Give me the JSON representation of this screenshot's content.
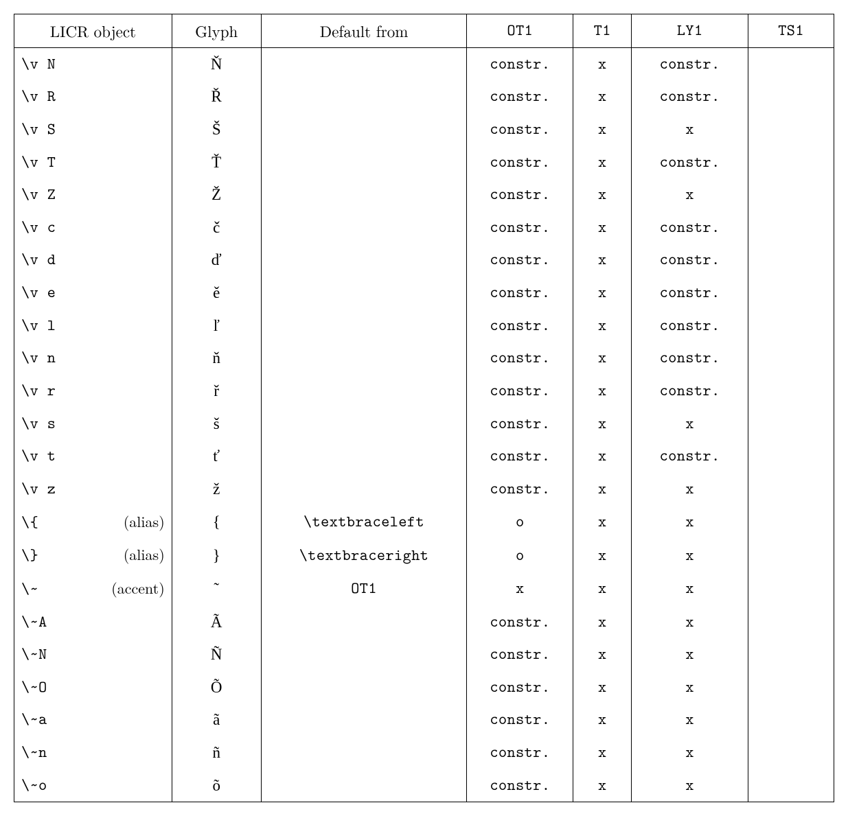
{
  "headers": {
    "licr": "LICR object",
    "glyph": "Glyph",
    "default_from": "Default from",
    "ot1": "OT1",
    "t1": "T1",
    "ly1": "LY1",
    "ts1": "TS1"
  },
  "rows": [
    {
      "licr": "\\v N",
      "glyph": "Ň",
      "default_from": "",
      "ot1": "constr.",
      "t1": "x",
      "ly1": "constr.",
      "ts1": ""
    },
    {
      "licr": "\\v R",
      "glyph": "Ř",
      "default_from": "",
      "ot1": "constr.",
      "t1": "x",
      "ly1": "constr.",
      "ts1": ""
    },
    {
      "licr": "\\v S",
      "glyph": "Š",
      "default_from": "",
      "ot1": "constr.",
      "t1": "x",
      "ly1": "x",
      "ts1": ""
    },
    {
      "licr": "\\v T",
      "glyph": "Ť",
      "default_from": "",
      "ot1": "constr.",
      "t1": "x",
      "ly1": "constr.",
      "ts1": ""
    },
    {
      "licr": "\\v Z",
      "glyph": "Ž",
      "default_from": "",
      "ot1": "constr.",
      "t1": "x",
      "ly1": "x",
      "ts1": ""
    },
    {
      "licr": "\\v c",
      "glyph": "č",
      "default_from": "",
      "ot1": "constr.",
      "t1": "x",
      "ly1": "constr.",
      "ts1": ""
    },
    {
      "licr": "\\v d",
      "glyph": "ď",
      "default_from": "",
      "ot1": "constr.",
      "t1": "x",
      "ly1": "constr.",
      "ts1": ""
    },
    {
      "licr": "\\v e",
      "glyph": "ě",
      "default_from": "",
      "ot1": "constr.",
      "t1": "x",
      "ly1": "constr.",
      "ts1": ""
    },
    {
      "licr": "\\v l",
      "glyph": "ľ",
      "default_from": "",
      "ot1": "constr.",
      "t1": "x",
      "ly1": "constr.",
      "ts1": ""
    },
    {
      "licr": "\\v n",
      "glyph": "ň",
      "default_from": "",
      "ot1": "constr.",
      "t1": "x",
      "ly1": "constr.",
      "ts1": ""
    },
    {
      "licr": "\\v r",
      "glyph": "ř",
      "default_from": "",
      "ot1": "constr.",
      "t1": "x",
      "ly1": "constr.",
      "ts1": ""
    },
    {
      "licr": "\\v s",
      "glyph": "š",
      "default_from": "",
      "ot1": "constr.",
      "t1": "x",
      "ly1": "x",
      "ts1": ""
    },
    {
      "licr": "\\v t",
      "glyph": "ť",
      "default_from": "",
      "ot1": "constr.",
      "t1": "x",
      "ly1": "constr.",
      "ts1": ""
    },
    {
      "licr": "\\v z",
      "glyph": "ž",
      "default_from": "",
      "ot1": "constr.",
      "t1": "x",
      "ly1": "x",
      "ts1": ""
    },
    {
      "licr": "\\{",
      "note": "(alias)",
      "glyph": "{",
      "default_from": "\\textbraceleft",
      "default_mono": true,
      "ot1": "o",
      "t1": "x",
      "ly1": "x",
      "ts1": ""
    },
    {
      "licr": "\\}",
      "note": "(alias)",
      "glyph": "}",
      "default_from": "\\textbraceright",
      "default_mono": true,
      "ot1": "o",
      "t1": "x",
      "ly1": "x",
      "ts1": ""
    },
    {
      "licr": "\\~",
      "note": "(accent)",
      "glyph": "˜",
      "default_from": "OT1",
      "default_mono": true,
      "ot1": "x",
      "t1": "x",
      "ly1": "x",
      "ts1": ""
    },
    {
      "licr": "\\~A",
      "glyph": "Ã",
      "default_from": "",
      "ot1": "constr.",
      "t1": "x",
      "ly1": "x",
      "ts1": ""
    },
    {
      "licr": "\\~N",
      "glyph": "Ñ",
      "default_from": "",
      "ot1": "constr.",
      "t1": "x",
      "ly1": "x",
      "ts1": ""
    },
    {
      "licr": "\\~O",
      "glyph": "Õ",
      "default_from": "",
      "ot1": "constr.",
      "t1": "x",
      "ly1": "x",
      "ts1": ""
    },
    {
      "licr": "\\~a",
      "glyph": "ã",
      "default_from": "",
      "ot1": "constr.",
      "t1": "x",
      "ly1": "x",
      "ts1": ""
    },
    {
      "licr": "\\~n",
      "glyph": "ñ",
      "default_from": "",
      "ot1": "constr.",
      "t1": "x",
      "ly1": "x",
      "ts1": ""
    },
    {
      "licr": "\\~o",
      "glyph": "õ",
      "default_from": "",
      "ot1": "constr.",
      "t1": "x",
      "ly1": "x",
      "ts1": ""
    }
  ]
}
